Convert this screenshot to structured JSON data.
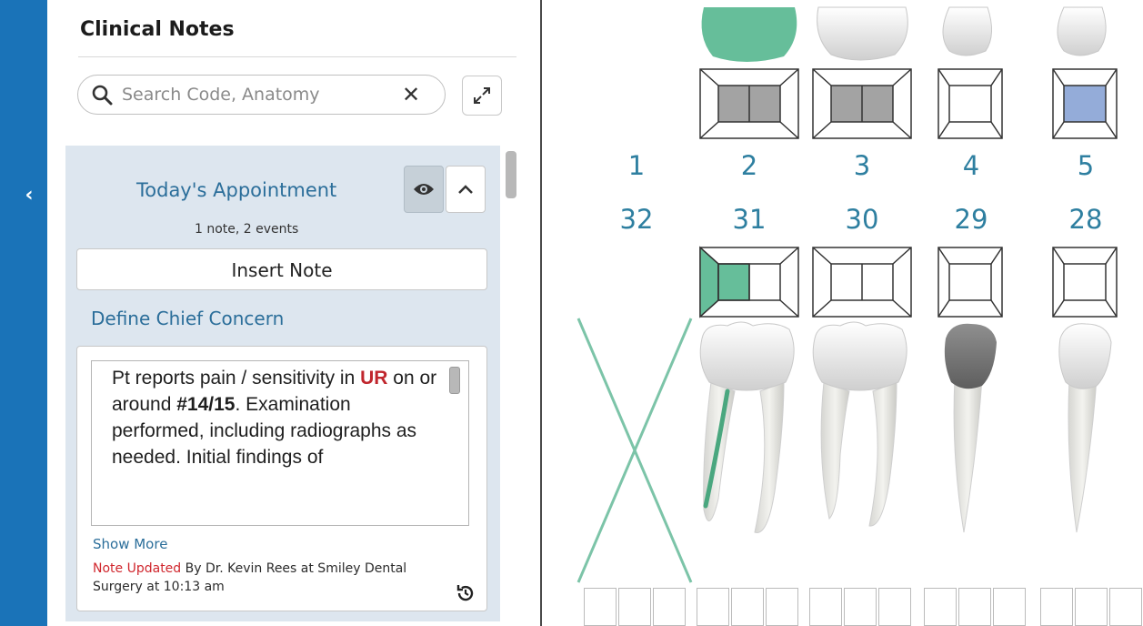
{
  "panel": {
    "title": "Clinical Notes",
    "search_placeholder": "Search Code, Anatomy",
    "appointment": {
      "title": "Today's Appointment",
      "subtitle": "1 note,  2 events",
      "insert_label": "Insert Note",
      "section_title": "Define Chief Concern"
    },
    "note": {
      "p1": "Pt reports pain / sensitivity in ",
      "region": "UR",
      "p2": " on or around ",
      "tooth": "#14/15",
      "p3": ". Examination performed, including radiographs as needed. Initial findings of",
      "show_more": "Show More",
      "updated_label": "Note Updated",
      "updated_text": " By Dr. Kevin Rees at Smiley Dental Surgery at 10:13 am"
    }
  },
  "chart": {
    "upper_numbers": [
      "1",
      "2",
      "3",
      "4",
      "5"
    ],
    "lower_numbers": [
      "32",
      "31",
      "30",
      "29",
      "28"
    ]
  },
  "colors": {
    "rail": "#1a73b8",
    "accent_text": "#2b6e9a",
    "tooth_number": "#2e7fa0",
    "green": "#5fb892",
    "blue_fill": "#94acd9",
    "red": "#c0262d"
  }
}
